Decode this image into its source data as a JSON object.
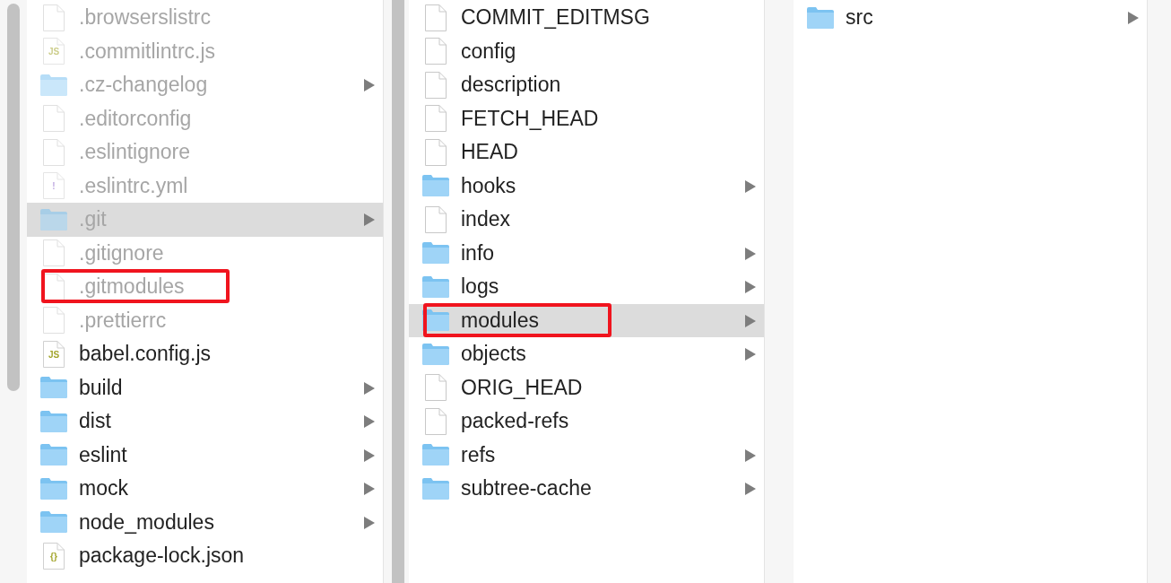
{
  "columns": [
    {
      "items": [
        {
          "name": ".browserslistrc",
          "kind": "file",
          "hidden": true,
          "selected": false,
          "highlighted": false
        },
        {
          "name": ".commitlintrc.js",
          "kind": "js",
          "icon_label": "JS",
          "hidden": true,
          "selected": false,
          "highlighted": false
        },
        {
          "name": ".cz-changelog",
          "kind": "folder",
          "hidden": true,
          "selected": false,
          "highlighted": false
        },
        {
          "name": ".editorconfig",
          "kind": "file",
          "hidden": true,
          "selected": false,
          "highlighted": false
        },
        {
          "name": ".eslintignore",
          "kind": "file",
          "hidden": true,
          "selected": false,
          "highlighted": false
        },
        {
          "name": ".eslintrc.yml",
          "kind": "yaml",
          "icon_label": "!",
          "hidden": true,
          "selected": false,
          "highlighted": false
        },
        {
          "name": ".git",
          "kind": "folder",
          "hidden": true,
          "selected": true,
          "highlighted": false
        },
        {
          "name": ".gitignore",
          "kind": "file",
          "hidden": true,
          "selected": false,
          "highlighted": false
        },
        {
          "name": ".gitmodules",
          "kind": "file",
          "hidden": true,
          "selected": false,
          "highlighted": true
        },
        {
          "name": ".prettierrc",
          "kind": "file",
          "hidden": true,
          "selected": false,
          "highlighted": false
        },
        {
          "name": "babel.config.js",
          "kind": "js",
          "icon_label": "JS",
          "hidden": false,
          "selected": false,
          "highlighted": false
        },
        {
          "name": "build",
          "kind": "folder",
          "hidden": false,
          "selected": false,
          "highlighted": false
        },
        {
          "name": "dist",
          "kind": "folder",
          "hidden": false,
          "selected": false,
          "highlighted": false
        },
        {
          "name": "eslint",
          "kind": "folder",
          "hidden": false,
          "selected": false,
          "highlighted": false
        },
        {
          "name": "mock",
          "kind": "folder",
          "hidden": false,
          "selected": false,
          "highlighted": false
        },
        {
          "name": "node_modules",
          "kind": "folder",
          "hidden": false,
          "selected": false,
          "highlighted": false
        },
        {
          "name": "package-lock.json",
          "kind": "json",
          "icon_label": "{}",
          "hidden": false,
          "selected": false,
          "highlighted": false
        }
      ]
    },
    {
      "items": [
        {
          "name": "COMMIT_EDITMSG",
          "kind": "file",
          "hidden": false,
          "selected": false,
          "highlighted": false
        },
        {
          "name": "config",
          "kind": "file",
          "hidden": false,
          "selected": false,
          "highlighted": false
        },
        {
          "name": "description",
          "kind": "file",
          "hidden": false,
          "selected": false,
          "highlighted": false
        },
        {
          "name": "FETCH_HEAD",
          "kind": "file",
          "hidden": false,
          "selected": false,
          "highlighted": false
        },
        {
          "name": "HEAD",
          "kind": "file",
          "hidden": false,
          "selected": false,
          "highlighted": false
        },
        {
          "name": "hooks",
          "kind": "folder",
          "hidden": false,
          "selected": false,
          "highlighted": false
        },
        {
          "name": "index",
          "kind": "file",
          "hidden": false,
          "selected": false,
          "highlighted": false
        },
        {
          "name": "info",
          "kind": "folder",
          "hidden": false,
          "selected": false,
          "highlighted": false
        },
        {
          "name": "logs",
          "kind": "folder",
          "hidden": false,
          "selected": false,
          "highlighted": false
        },
        {
          "name": "modules",
          "kind": "folder",
          "hidden": false,
          "selected": true,
          "highlighted": true
        },
        {
          "name": "objects",
          "kind": "folder",
          "hidden": false,
          "selected": false,
          "highlighted": false
        },
        {
          "name": "ORIG_HEAD",
          "kind": "file",
          "hidden": false,
          "selected": false,
          "highlighted": false
        },
        {
          "name": "packed-refs",
          "kind": "file",
          "hidden": false,
          "selected": false,
          "highlighted": false
        },
        {
          "name": "refs",
          "kind": "folder",
          "hidden": false,
          "selected": false,
          "highlighted": false
        },
        {
          "name": "subtree-cache",
          "kind": "folder",
          "hidden": false,
          "selected": false,
          "highlighted": false
        }
      ]
    },
    {
      "items": [
        {
          "name": "src",
          "kind": "folder",
          "hidden": false,
          "selected": false,
          "highlighted": false
        }
      ]
    }
  ]
}
